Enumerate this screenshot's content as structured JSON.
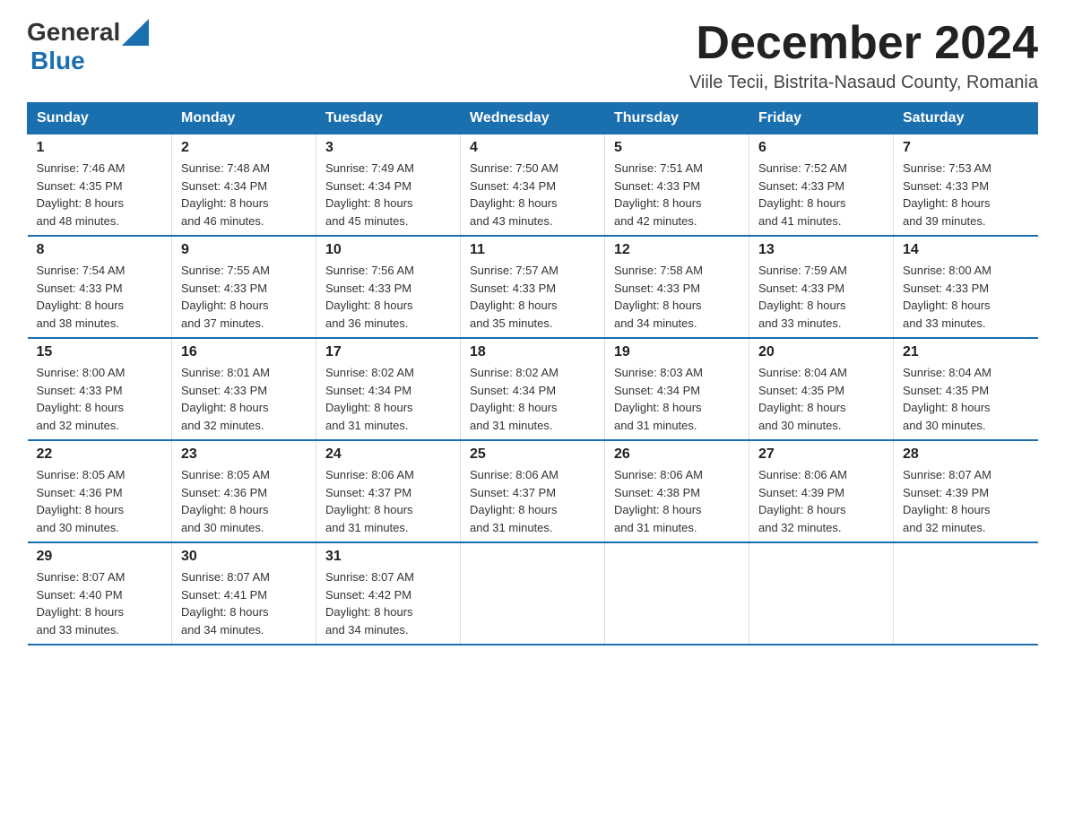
{
  "logo": {
    "general": "General",
    "blue": "Blue"
  },
  "header": {
    "title": "December 2024",
    "subtitle": "Viile Tecii, Bistrita-Nasaud County, Romania"
  },
  "days_of_week": [
    "Sunday",
    "Monday",
    "Tuesday",
    "Wednesday",
    "Thursday",
    "Friday",
    "Saturday"
  ],
  "weeks": [
    [
      {
        "day": "1",
        "sunrise": "7:46 AM",
        "sunset": "4:35 PM",
        "daylight": "8 hours and 48 minutes."
      },
      {
        "day": "2",
        "sunrise": "7:48 AM",
        "sunset": "4:34 PM",
        "daylight": "8 hours and 46 minutes."
      },
      {
        "day": "3",
        "sunrise": "7:49 AM",
        "sunset": "4:34 PM",
        "daylight": "8 hours and 45 minutes."
      },
      {
        "day": "4",
        "sunrise": "7:50 AM",
        "sunset": "4:34 PM",
        "daylight": "8 hours and 43 minutes."
      },
      {
        "day": "5",
        "sunrise": "7:51 AM",
        "sunset": "4:33 PM",
        "daylight": "8 hours and 42 minutes."
      },
      {
        "day": "6",
        "sunrise": "7:52 AM",
        "sunset": "4:33 PM",
        "daylight": "8 hours and 41 minutes."
      },
      {
        "day": "7",
        "sunrise": "7:53 AM",
        "sunset": "4:33 PM",
        "daylight": "8 hours and 39 minutes."
      }
    ],
    [
      {
        "day": "8",
        "sunrise": "7:54 AM",
        "sunset": "4:33 PM",
        "daylight": "8 hours and 38 minutes."
      },
      {
        "day": "9",
        "sunrise": "7:55 AM",
        "sunset": "4:33 PM",
        "daylight": "8 hours and 37 minutes."
      },
      {
        "day": "10",
        "sunrise": "7:56 AM",
        "sunset": "4:33 PM",
        "daylight": "8 hours and 36 minutes."
      },
      {
        "day": "11",
        "sunrise": "7:57 AM",
        "sunset": "4:33 PM",
        "daylight": "8 hours and 35 minutes."
      },
      {
        "day": "12",
        "sunrise": "7:58 AM",
        "sunset": "4:33 PM",
        "daylight": "8 hours and 34 minutes."
      },
      {
        "day": "13",
        "sunrise": "7:59 AM",
        "sunset": "4:33 PM",
        "daylight": "8 hours and 33 minutes."
      },
      {
        "day": "14",
        "sunrise": "8:00 AM",
        "sunset": "4:33 PM",
        "daylight": "8 hours and 33 minutes."
      }
    ],
    [
      {
        "day": "15",
        "sunrise": "8:00 AM",
        "sunset": "4:33 PM",
        "daylight": "8 hours and 32 minutes."
      },
      {
        "day": "16",
        "sunrise": "8:01 AM",
        "sunset": "4:33 PM",
        "daylight": "8 hours and 32 minutes."
      },
      {
        "day": "17",
        "sunrise": "8:02 AM",
        "sunset": "4:34 PM",
        "daylight": "8 hours and 31 minutes."
      },
      {
        "day": "18",
        "sunrise": "8:02 AM",
        "sunset": "4:34 PM",
        "daylight": "8 hours and 31 minutes."
      },
      {
        "day": "19",
        "sunrise": "8:03 AM",
        "sunset": "4:34 PM",
        "daylight": "8 hours and 31 minutes."
      },
      {
        "day": "20",
        "sunrise": "8:04 AM",
        "sunset": "4:35 PM",
        "daylight": "8 hours and 30 minutes."
      },
      {
        "day": "21",
        "sunrise": "8:04 AM",
        "sunset": "4:35 PM",
        "daylight": "8 hours and 30 minutes."
      }
    ],
    [
      {
        "day": "22",
        "sunrise": "8:05 AM",
        "sunset": "4:36 PM",
        "daylight": "8 hours and 30 minutes."
      },
      {
        "day": "23",
        "sunrise": "8:05 AM",
        "sunset": "4:36 PM",
        "daylight": "8 hours and 30 minutes."
      },
      {
        "day": "24",
        "sunrise": "8:06 AM",
        "sunset": "4:37 PM",
        "daylight": "8 hours and 31 minutes."
      },
      {
        "day": "25",
        "sunrise": "8:06 AM",
        "sunset": "4:37 PM",
        "daylight": "8 hours and 31 minutes."
      },
      {
        "day": "26",
        "sunrise": "8:06 AM",
        "sunset": "4:38 PM",
        "daylight": "8 hours and 31 minutes."
      },
      {
        "day": "27",
        "sunrise": "8:06 AM",
        "sunset": "4:39 PM",
        "daylight": "8 hours and 32 minutes."
      },
      {
        "day": "28",
        "sunrise": "8:07 AM",
        "sunset": "4:39 PM",
        "daylight": "8 hours and 32 minutes."
      }
    ],
    [
      {
        "day": "29",
        "sunrise": "8:07 AM",
        "sunset": "4:40 PM",
        "daylight": "8 hours and 33 minutes."
      },
      {
        "day": "30",
        "sunrise": "8:07 AM",
        "sunset": "4:41 PM",
        "daylight": "8 hours and 34 minutes."
      },
      {
        "day": "31",
        "sunrise": "8:07 AM",
        "sunset": "4:42 PM",
        "daylight": "8 hours and 34 minutes."
      },
      null,
      null,
      null,
      null
    ]
  ],
  "labels": {
    "sunrise": "Sunrise:",
    "sunset": "Sunset:",
    "daylight": "Daylight:"
  }
}
